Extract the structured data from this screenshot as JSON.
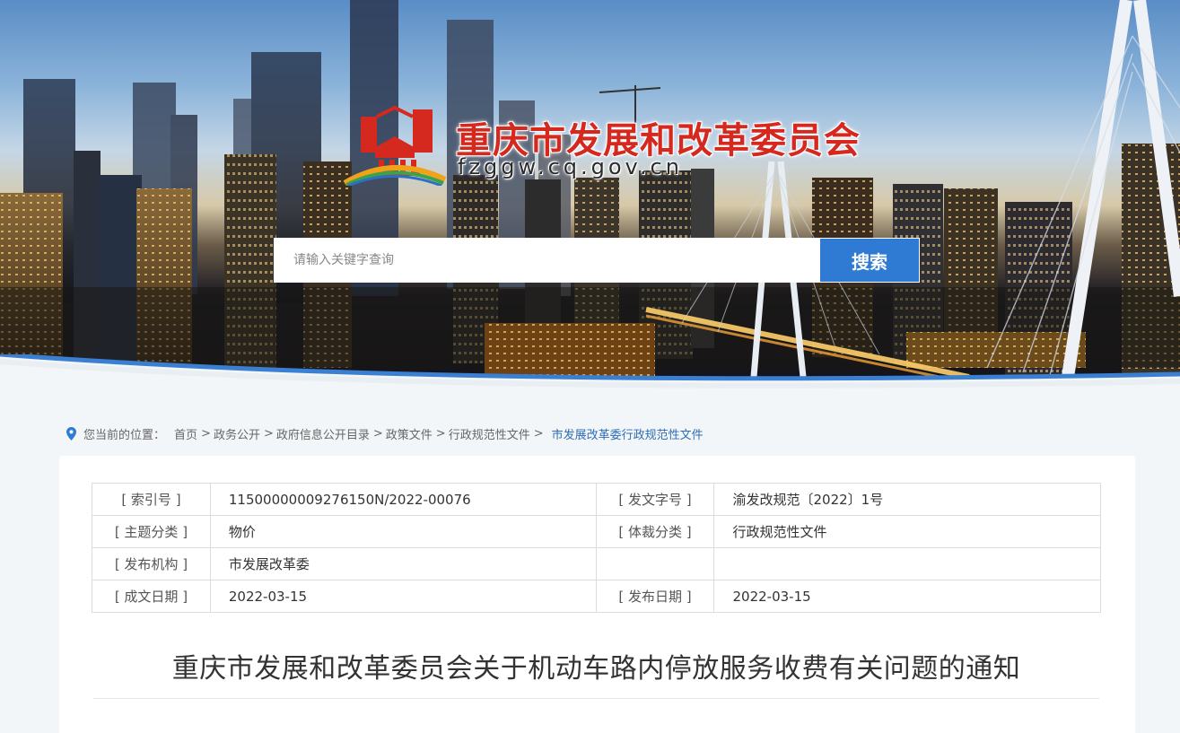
{
  "header": {
    "site_title": "重庆市发展和改革委员会",
    "site_domain": "fzggw.cq.gov.cn",
    "search_placeholder": "请输入关键字查询",
    "search_button": "搜索"
  },
  "breadcrumb": {
    "label": "您当前的位置：",
    "items": [
      "首页",
      "政务公开",
      "政府信息公开目录",
      "政策文件",
      "行政规范性文件"
    ],
    "current": "市发展改革委行政规范性文件"
  },
  "meta": {
    "index_no_label": "[ 索引号 ]",
    "index_no": "11500000009276150N/2022-00076",
    "doc_no_label": "[ 发文字号 ]",
    "doc_no": "渝发改规范〔2022〕1号",
    "topic_label": "[ 主题分类 ]",
    "topic": "物价",
    "genre_label": "[ 体裁分类 ]",
    "genre": "行政规范性文件",
    "issuer_label": "[ 发布机构 ]",
    "issuer": "市发展改革委",
    "created_label": "[ 成文日期 ]",
    "created": "2022-03-15",
    "published_label": "[ 发布日期 ]",
    "published": "2022-03-15"
  },
  "document": {
    "title": "重庆市发展和改革委员会关于机动车路内停放服务收费有关问题的通知"
  },
  "colors": {
    "title_red": "#d5281e",
    "accent_blue": "#2f7bd3",
    "link_blue": "#2f6db5"
  }
}
